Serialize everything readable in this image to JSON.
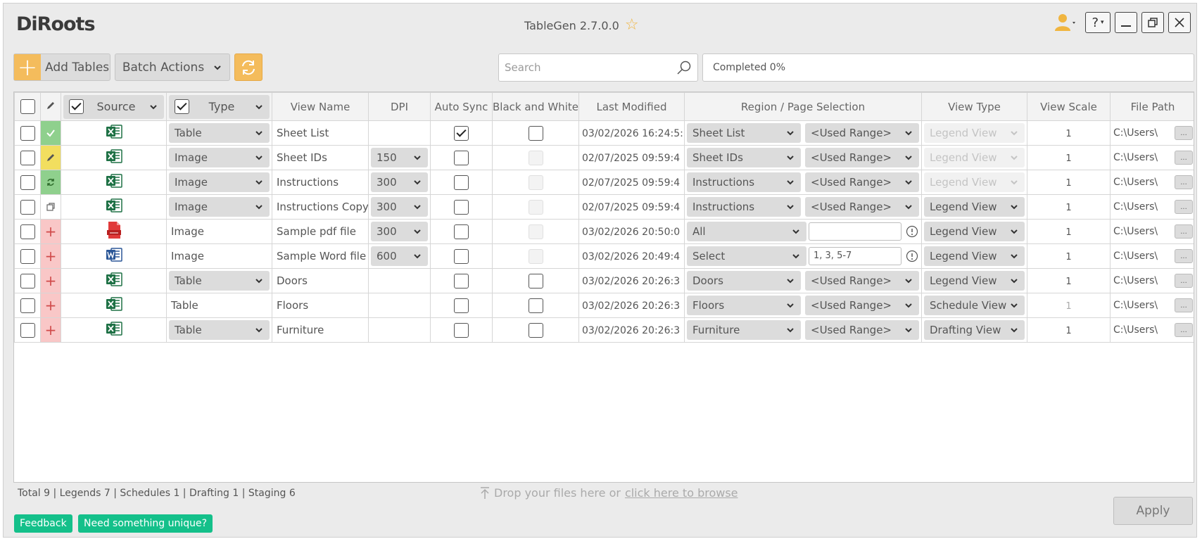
{
  "app": {
    "logo": "DiRoots",
    "title": "TableGen 2.7.0.0"
  },
  "window": {
    "help_label": "?"
  },
  "toolbar": {
    "add_tables_label": "Add Tables",
    "batch_actions_label": "Batch Actions",
    "search_placeholder": "Search",
    "progress_text": "Completed 0%"
  },
  "columns": {
    "source": "Source",
    "type": "Type",
    "view_name": "View Name",
    "dpi": "DPI",
    "auto_sync": "Auto Sync",
    "black_white": "Black and White",
    "last_modified": "Last Modified",
    "region": "Region / Page Selection",
    "view_type": "View Type",
    "view_scale": "View Scale",
    "file_path": "File Path"
  },
  "rows": [
    {
      "status_icon": "check-icon",
      "source_icon": "excel-icon",
      "type": "Table",
      "view_name": "Sheet List",
      "dpi": "",
      "auto_sync": true,
      "bw": false,
      "bw_disabled": false,
      "modified": "03/02/2026 16:24:5:",
      "region": "Sheet List",
      "range": "<Used Range>",
      "view_type": "Legend View",
      "view_type_disabled": true,
      "scale": "1",
      "path": "C:\\Users\\"
    },
    {
      "status_icon": "pencil-icon",
      "source_icon": "excel-icon",
      "type": "Image",
      "view_name": "Sheet IDs",
      "dpi": "150",
      "auto_sync": false,
      "bw": false,
      "bw_disabled": true,
      "modified": "02/07/2025 09:59:4",
      "region": "Sheet IDs",
      "range": "<Used Range>",
      "view_type": "Legend View",
      "view_type_disabled": true,
      "scale": "1",
      "path": "C:\\Users\\"
    },
    {
      "status_icon": "sync-icon",
      "source_icon": "excel-icon",
      "type": "Image",
      "view_name": "Instructions",
      "dpi": "300",
      "auto_sync": false,
      "bw": false,
      "bw_disabled": true,
      "modified": "02/07/2025 09:59:4",
      "region": "Instructions",
      "range": "<Used Range>",
      "view_type": "Legend View",
      "view_type_disabled": true,
      "scale": "1",
      "path": "C:\\Users\\"
    },
    {
      "status_icon": "copy-icon",
      "source_icon": "excel-icon",
      "type": "Image",
      "view_name": "Instructions Copy",
      "dpi": "300",
      "auto_sync": false,
      "bw": false,
      "bw_disabled": true,
      "modified": "02/07/2025 09:59:4",
      "region": "Instructions",
      "range": "<Used Range>",
      "view_type": "Legend View",
      "view_type_disabled": false,
      "scale": "1",
      "path": "C:\\Users\\"
    },
    {
      "status_icon": "plus-icon",
      "source_icon": "pdf-icon",
      "type": "Image",
      "type_plain": true,
      "view_name": "Sample pdf file",
      "dpi": "300",
      "auto_sync": false,
      "bw": false,
      "bw_disabled": true,
      "modified": "03/02/2026 20:50:0",
      "region": "All",
      "range_input": "",
      "view_type": "Legend View",
      "view_type_disabled": false,
      "scale": "1",
      "path": "C:\\Users\\"
    },
    {
      "status_icon": "plus-icon",
      "source_icon": "word-icon",
      "type": "Image",
      "type_plain": true,
      "view_name": "Sample Word file",
      "dpi": "600",
      "auto_sync": false,
      "bw": false,
      "bw_disabled": true,
      "modified": "03/02/2026 20:49:4",
      "region": "Select",
      "range_input": "1, 3, 5-7",
      "view_type": "Legend View",
      "view_type_disabled": false,
      "scale": "1",
      "path": "C:\\Users\\"
    },
    {
      "status_icon": "plus-icon",
      "source_icon": "excel-icon",
      "type": "Table",
      "view_name": "Doors",
      "dpi": "",
      "auto_sync": false,
      "bw": false,
      "bw_disabled": false,
      "modified": "03/02/2026 20:26:3",
      "region": "Doors",
      "range": "<Used Range>",
      "view_type": "Legend View",
      "view_type_disabled": false,
      "scale": "1",
      "path": "C:\\Users\\"
    },
    {
      "status_icon": "plus-icon",
      "source_icon": "excel-icon",
      "type": "Table",
      "type_plain": true,
      "view_name": "Floors",
      "dpi": "",
      "auto_sync": false,
      "bw": false,
      "bw_disabled": false,
      "modified": "03/02/2026 20:26:3",
      "region": "Floors",
      "range": "<Used Range>",
      "view_type": "Schedule View",
      "view_type_disabled": false,
      "scale": "1",
      "scale_dim": true,
      "path": "C:\\Users\\"
    },
    {
      "status_icon": "plus-icon",
      "source_icon": "excel-icon",
      "type": "Table",
      "view_name": "Furniture",
      "dpi": "",
      "auto_sync": false,
      "bw": false,
      "bw_disabled": false,
      "modified": "03/02/2026 20:26:3",
      "region": "Furniture",
      "range": "<Used Range>",
      "view_type": "Drafting View",
      "view_type_disabled": false,
      "scale": "1",
      "path": "C:\\Users\\"
    }
  ],
  "path_button_label": "...",
  "footer": {
    "summary": "Total 9 | Legends 7 | Schedules 1 | Drafting 1 | Staging 6",
    "drop_text": "Drop your files here or ",
    "browse_link": "click here to browse",
    "apply_label": "Apply",
    "feedback_label": "Feedback",
    "unique_label": "Need something unique?"
  },
  "colors": {
    "accent": "#f4bc5c",
    "green": "#14c08a",
    "excel": "#1e7145",
    "word": "#2b5797",
    "pdf": "#e03a3a"
  }
}
